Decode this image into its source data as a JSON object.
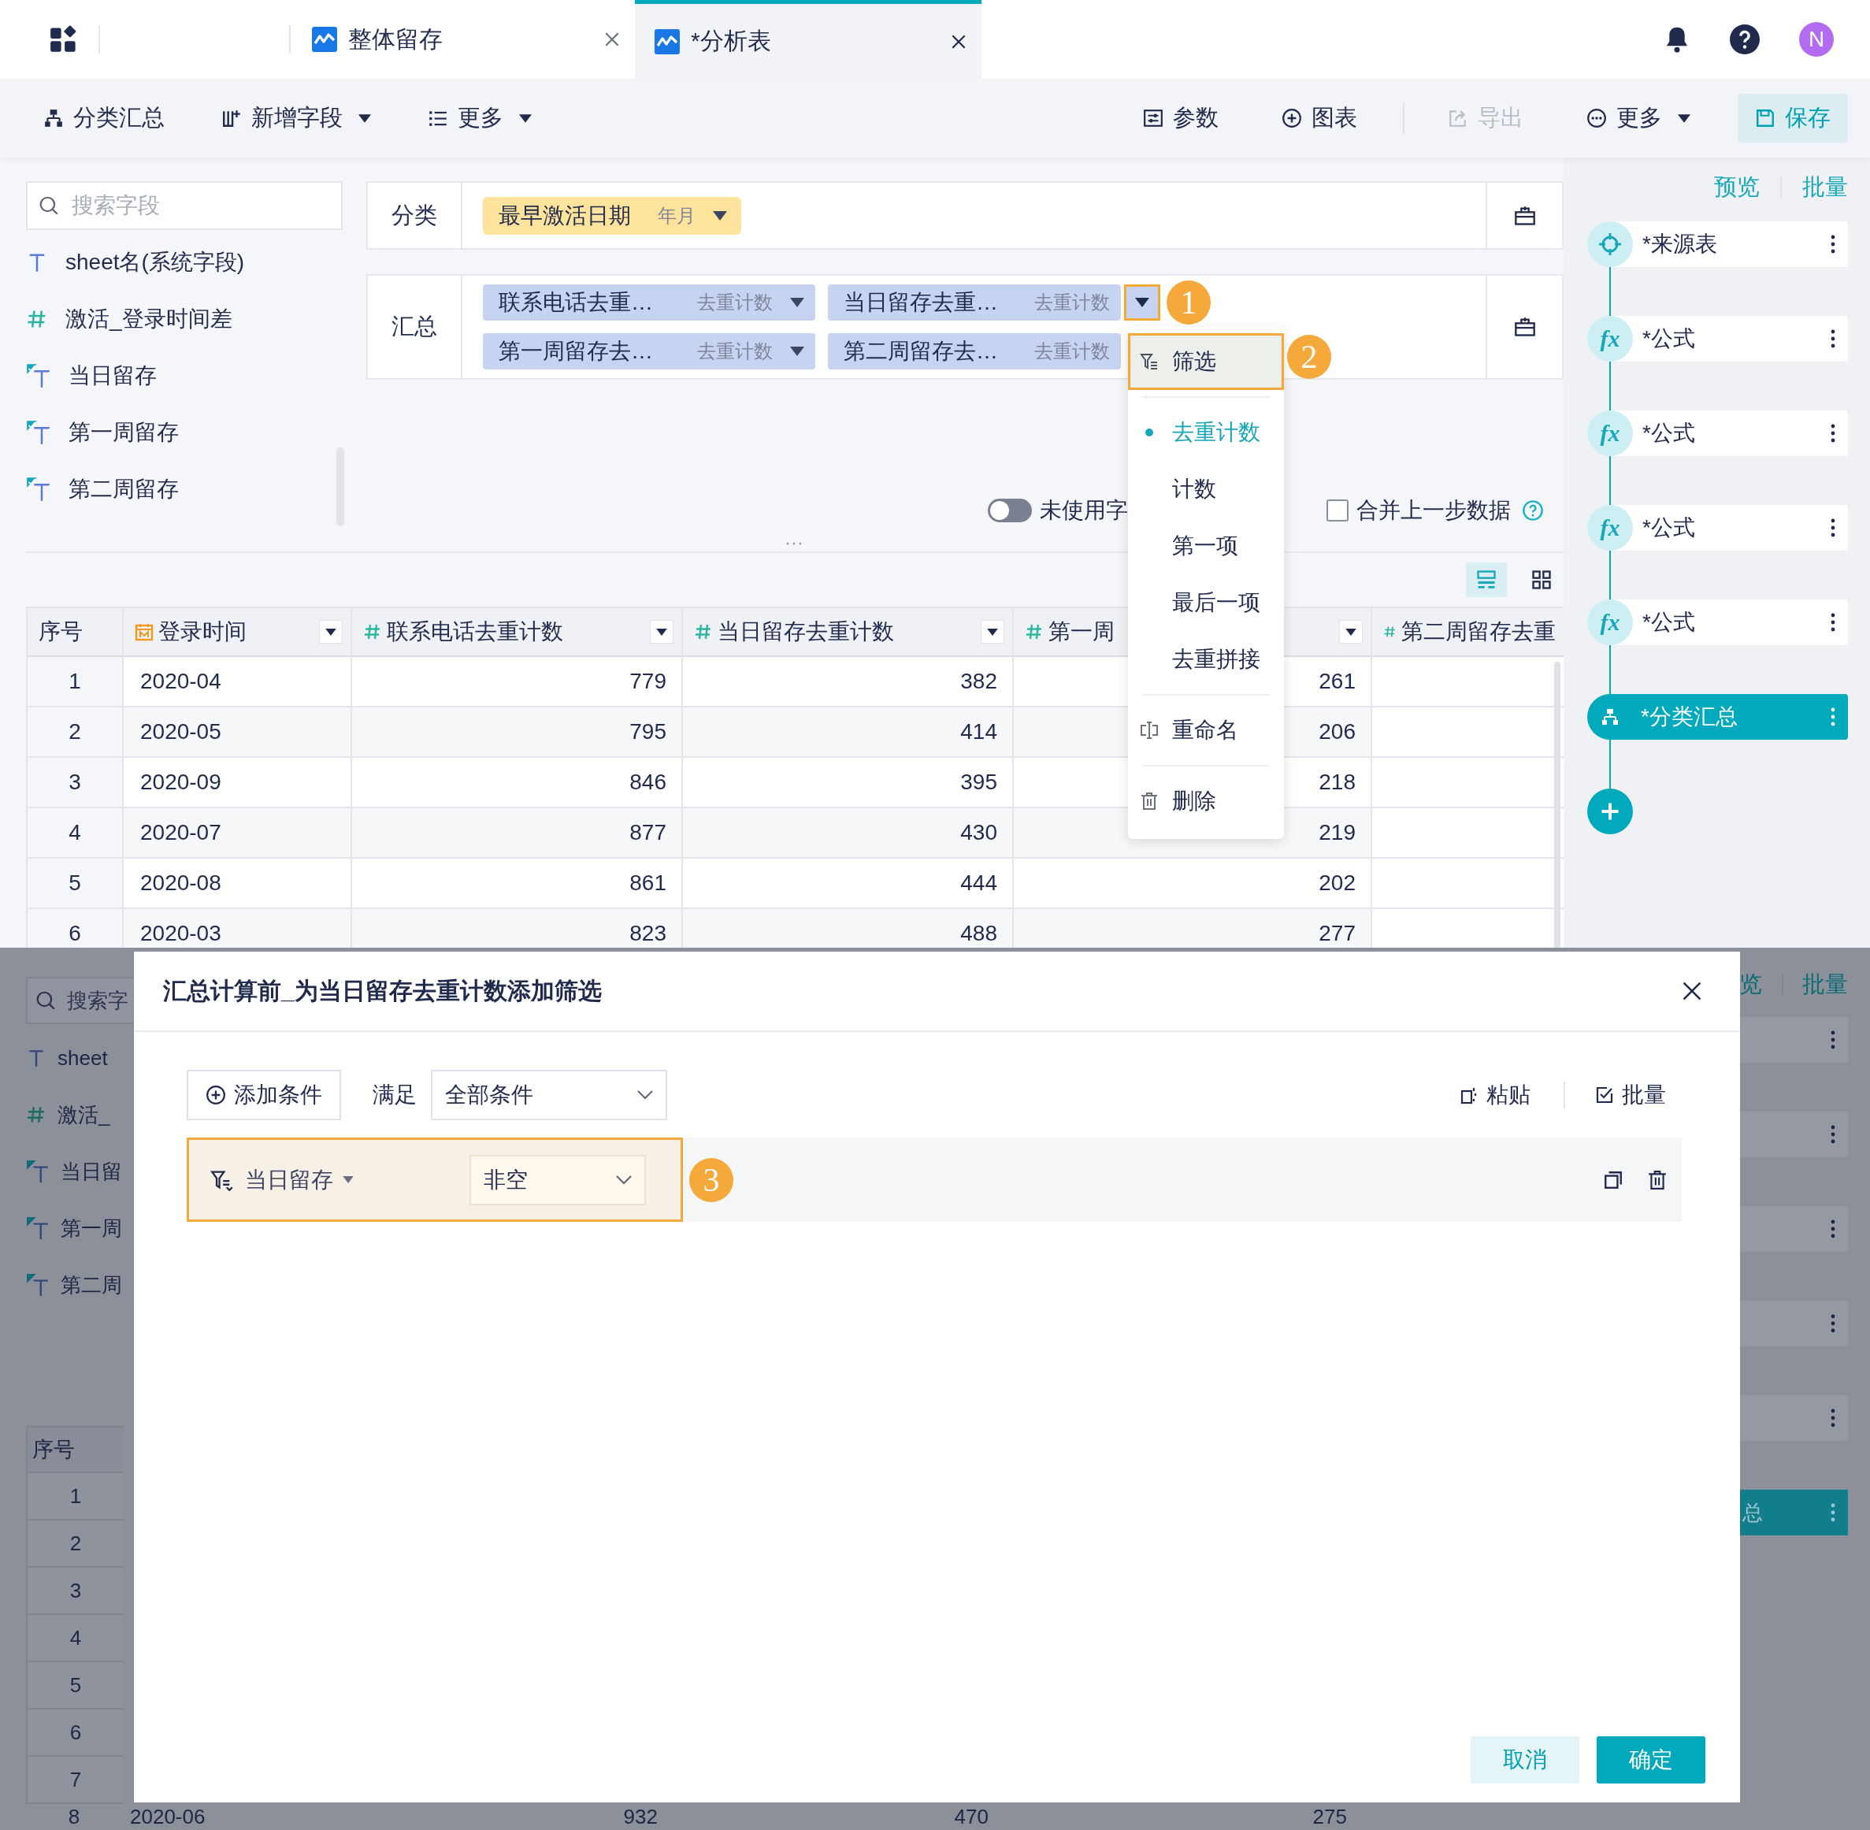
{
  "tabs": [
    {
      "label": "整体留存",
      "selected": false
    },
    {
      "label": "*分析表",
      "selected": true
    }
  ],
  "avatar": "N",
  "toolbar": {
    "left": [
      {
        "label": "分类汇总",
        "kind": "tree",
        "dropdown": false
      },
      {
        "label": "新增字段",
        "kind": "add-field",
        "dropdown": true
      },
      {
        "label": "更多",
        "kind": "list",
        "dropdown": true
      }
    ],
    "right_groups": [
      [
        {
          "label": "参数",
          "kind": "params",
          "dropdown": false,
          "disabled": false
        },
        {
          "label": "图表",
          "kind": "plus-circle",
          "dropdown": false,
          "disabled": false
        }
      ],
      [
        {
          "label": "导出",
          "kind": "export",
          "dropdown": false,
          "disabled": true
        },
        {
          "label": "更多",
          "kind": "dots",
          "dropdown": true,
          "disabled": false
        }
      ]
    ],
    "save": "保存"
  },
  "fields": {
    "placeholder": "搜索字段",
    "items": [
      {
        "name": "sheet名(系统字段)",
        "kind": "text"
      },
      {
        "name": "激活_登录时间差",
        "kind": "number"
      },
      {
        "name": "当日留存",
        "kind": "formula-text"
      },
      {
        "name": "第一周留存",
        "kind": "formula-text"
      },
      {
        "name": "第二周留存",
        "kind": "formula-text"
      }
    ]
  },
  "classify": {
    "label": "分类",
    "pills": [
      {
        "name": "最早激活日期",
        "agg": "年月"
      }
    ]
  },
  "summary": {
    "label": "汇总",
    "pills": [
      {
        "name": "联系电话去重…",
        "agg": "去重计数",
        "caret": true
      },
      {
        "name": "当日留存去重…",
        "agg": "去重计数",
        "caret": true,
        "step": "1"
      },
      {
        "name": "第一周留存去…",
        "agg": "去重计数",
        "caret": true
      },
      {
        "name": "第二周留存去…",
        "agg": "去重计数",
        "caret": false
      }
    ]
  },
  "options": {
    "toggle": {
      "label": "未使用字",
      "on": false
    },
    "merge": {
      "label": "合并上一步数据",
      "checked": false
    }
  },
  "table": {
    "columns": [
      {
        "label": "序号",
        "kind": "index"
      },
      {
        "label": "登录时间",
        "kind": "date"
      },
      {
        "label": "联系电话去重计数",
        "kind": "number"
      },
      {
        "label": "当日留存去重计数",
        "kind": "number"
      },
      {
        "label": "第一周",
        "kind": "number"
      },
      {
        "label": "第二周留存去重",
        "kind": "number"
      }
    ],
    "rows": [
      [
        "1",
        "2020-04",
        "779",
        "382",
        "261"
      ],
      [
        "2",
        "2020-05",
        "795",
        "414",
        "206"
      ],
      [
        "3",
        "2020-09",
        "846",
        "395",
        "218"
      ],
      [
        "4",
        "2020-07",
        "877",
        "430",
        "219"
      ],
      [
        "5",
        "2020-08",
        "861",
        "444",
        "202"
      ],
      [
        "6",
        "2020-03",
        "823",
        "488",
        "277"
      ]
    ]
  },
  "menu": {
    "items": [
      {
        "kind": "filter",
        "label": "筛选",
        "step": "2"
      },
      {
        "kind": "divider"
      },
      {
        "kind": "agg",
        "label": "去重计数",
        "selected": true
      },
      {
        "kind": "agg",
        "label": "计数",
        "selected": false
      },
      {
        "kind": "agg",
        "label": "第一项",
        "selected": false
      },
      {
        "kind": "agg",
        "label": "最后一项",
        "selected": false
      },
      {
        "kind": "agg",
        "label": "去重拼接",
        "selected": false
      },
      {
        "kind": "divider"
      },
      {
        "kind": "rename",
        "label": "重命名"
      },
      {
        "kind": "divider"
      },
      {
        "kind": "delete",
        "label": "删除"
      }
    ]
  },
  "flow": {
    "links": [
      "预览",
      "批量"
    ],
    "nodes": [
      {
        "label": "*来源表",
        "kind": "source",
        "selected": false
      },
      {
        "label": "*公式",
        "kind": "formula",
        "icon_text": "fx",
        "selected": false
      },
      {
        "label": "*公式",
        "kind": "formula",
        "icon_text": "fx",
        "selected": false
      },
      {
        "label": "*公式",
        "kind": "formula",
        "icon_text": "fx",
        "selected": false
      },
      {
        "label": "*公式",
        "kind": "formula",
        "icon_text": "fx",
        "selected": false
      },
      {
        "label": "*分类汇总",
        "kind": "group",
        "selected": true
      }
    ]
  },
  "dialog": {
    "title": "汇总计算前_为当日留存去重计数添加筛选",
    "add_button": "添加条件",
    "match_label": "满足",
    "match_value": "全部条件",
    "actions": [
      {
        "label": "粘贴",
        "kind": "paste"
      },
      {
        "label": "批量",
        "kind": "batch"
      }
    ],
    "conditions": [
      {
        "field": "当日留存",
        "operator": "非空",
        "step": "3"
      }
    ],
    "buttons": [
      {
        "label": "取消",
        "kind": "secondary"
      },
      {
        "label": "确定",
        "kind": "primary"
      }
    ]
  },
  "backdrop": {
    "placeholder": "搜索字",
    "fields": [
      {
        "name": "sheet",
        "kind": "text"
      },
      {
        "name": "激活_",
        "kind": "number"
      },
      {
        "name": "当日留",
        "kind": "formula-text"
      },
      {
        "name": "第一周",
        "kind": "formula-text"
      },
      {
        "name": "第二周",
        "kind": "formula-text"
      }
    ],
    "index_header": "序号",
    "index_rows": [
      "1",
      "2",
      "3",
      "4",
      "5",
      "6",
      "7"
    ],
    "last_row": [
      "8",
      "2020-06",
      "932",
      "470",
      "275"
    ],
    "links": [
      "览",
      "批量"
    ],
    "nodes": [
      {
        "selected": false
      },
      {
        "selected": false
      },
      {
        "selected": false
      },
      {
        "selected": false
      },
      {
        "selected": false
      },
      {
        "label": "总",
        "selected": true
      }
    ]
  }
}
